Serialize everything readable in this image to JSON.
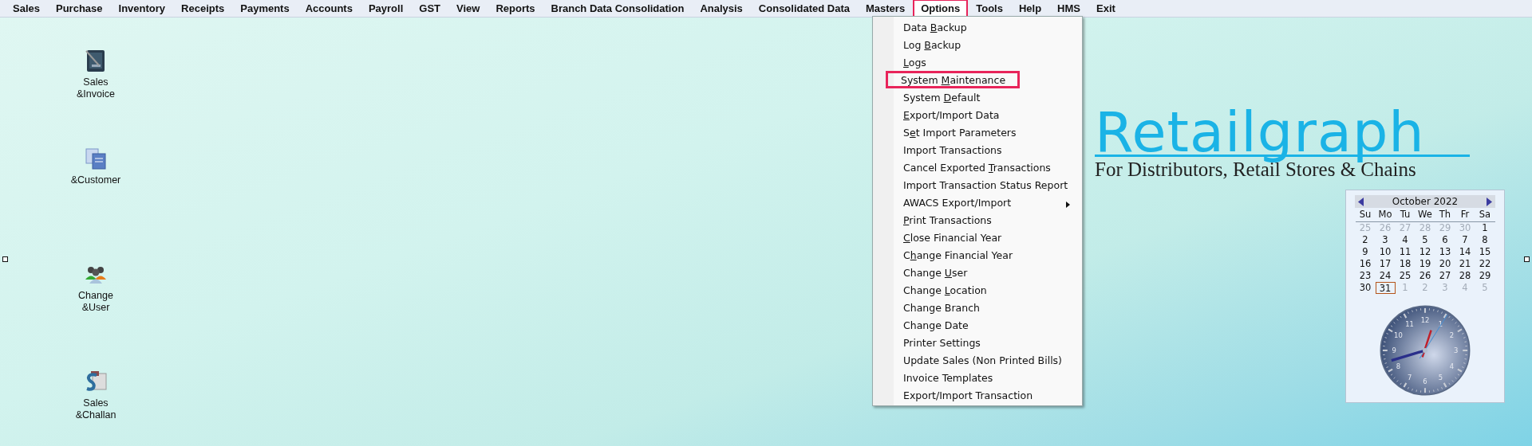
{
  "menu_bar": [
    {
      "label": "Sales",
      "highlighted": false
    },
    {
      "label": "Purchase",
      "highlighted": false
    },
    {
      "label": "Inventory",
      "highlighted": false
    },
    {
      "label": "Receipts",
      "highlighted": false
    },
    {
      "label": "Payments",
      "highlighted": false
    },
    {
      "label": "Accounts",
      "highlighted": false
    },
    {
      "label": "Payroll",
      "highlighted": false
    },
    {
      "label": "GST",
      "highlighted": false
    },
    {
      "label": "View",
      "highlighted": false
    },
    {
      "label": "Reports",
      "highlighted": false
    },
    {
      "label": "Branch Data Consolidation",
      "highlighted": false
    },
    {
      "label": "Analysis",
      "highlighted": false
    },
    {
      "label": "Consolidated Data",
      "highlighted": false
    },
    {
      "label": "Masters",
      "highlighted": false
    },
    {
      "label": "Options",
      "highlighted": true
    },
    {
      "label": "Tools",
      "highlighted": false
    },
    {
      "label": "Help",
      "highlighted": false
    },
    {
      "label": "HMS",
      "highlighted": false
    },
    {
      "label": "Exit",
      "highlighted": false
    }
  ],
  "options_menu": [
    {
      "parts": [
        {
          "text": "Data ",
          "underlined": false
        },
        {
          "text": "B",
          "underlined": true
        },
        {
          "text": "ackup",
          "underlined": false
        }
      ],
      "highlighted": false,
      "submenu": false
    },
    {
      "parts": [
        {
          "text": "Log ",
          "underlined": false
        },
        {
          "text": "B",
          "underlined": true
        },
        {
          "text": "ackup",
          "underlined": false
        }
      ],
      "highlighted": false,
      "submenu": false
    },
    {
      "parts": [
        {
          "text": "L",
          "underlined": true
        },
        {
          "text": "ogs",
          "underlined": false
        }
      ],
      "highlighted": false,
      "submenu": false
    },
    {
      "parts": [
        {
          "text": "System ",
          "underlined": false
        },
        {
          "text": "M",
          "underlined": true
        },
        {
          "text": "aintenance",
          "underlined": false
        }
      ],
      "highlighted": true,
      "submenu": false
    },
    {
      "parts": [
        {
          "text": "System ",
          "underlined": false
        },
        {
          "text": "D",
          "underlined": true
        },
        {
          "text": "efault",
          "underlined": false
        }
      ],
      "highlighted": false,
      "submenu": false
    },
    {
      "parts": [
        {
          "text": "E",
          "underlined": true
        },
        {
          "text": "xport/Import Data",
          "underlined": false
        }
      ],
      "highlighted": false,
      "submenu": false
    },
    {
      "parts": [
        {
          "text": "S",
          "underlined": false
        },
        {
          "text": "e",
          "underlined": true
        },
        {
          "text": "t Import Parameters",
          "underlined": false
        }
      ],
      "highlighted": false,
      "submenu": false
    },
    {
      "parts": [
        {
          "text": "Import Transactions",
          "underlined": false
        }
      ],
      "highlighted": false,
      "submenu": false
    },
    {
      "parts": [
        {
          "text": "Cancel Exported ",
          "underlined": false
        },
        {
          "text": "T",
          "underlined": true
        },
        {
          "text": "ransactions",
          "underlined": false
        }
      ],
      "highlighted": false,
      "submenu": false
    },
    {
      "parts": [
        {
          "text": "Import Transaction Status Report",
          "underlined": false
        }
      ],
      "highlighted": false,
      "submenu": false
    },
    {
      "parts": [
        {
          "text": "AWACS Export/Import",
          "underlined": false
        }
      ],
      "highlighted": false,
      "submenu": true
    },
    {
      "parts": [
        {
          "text": "P",
          "underlined": true
        },
        {
          "text": "rint Transactions",
          "underlined": false
        }
      ],
      "highlighted": false,
      "submenu": false
    },
    {
      "parts": [
        {
          "text": "C",
          "underlined": true
        },
        {
          "text": "lose Financial Year",
          "underlined": false
        }
      ],
      "highlighted": false,
      "submenu": false
    },
    {
      "parts": [
        {
          "text": "C",
          "underlined": false
        },
        {
          "text": "h",
          "underlined": true
        },
        {
          "text": "ange Financial Year",
          "underlined": false
        }
      ],
      "highlighted": false,
      "submenu": false
    },
    {
      "parts": [
        {
          "text": "Change ",
          "underlined": false
        },
        {
          "text": "U",
          "underlined": true
        },
        {
          "text": "ser",
          "underlined": false
        }
      ],
      "highlighted": false,
      "submenu": false
    },
    {
      "parts": [
        {
          "text": "Change ",
          "underlined": false
        },
        {
          "text": "L",
          "underlined": true
        },
        {
          "text": "ocation",
          "underlined": false
        }
      ],
      "highlighted": false,
      "submenu": false
    },
    {
      "parts": [
        {
          "text": "Change Branch",
          "underlined": false
        }
      ],
      "highlighted": false,
      "submenu": false
    },
    {
      "parts": [
        {
          "text": "Change Date",
          "underlined": false
        }
      ],
      "highlighted": false,
      "submenu": false
    },
    {
      "parts": [
        {
          "text": "Printer Settings",
          "underlined": false
        }
      ],
      "highlighted": false,
      "submenu": false
    },
    {
      "parts": [
        {
          "text": "Update Sales (Non Printed Bills)",
          "underlined": false
        }
      ],
      "highlighted": false,
      "submenu": false
    },
    {
      "parts": [
        {
          "text": "Invoice Templates",
          "underlined": false
        }
      ],
      "highlighted": false,
      "submenu": false
    },
    {
      "parts": [
        {
          "text": "Export/Import Transaction",
          "underlined": false
        }
      ],
      "highlighted": false,
      "submenu": false
    }
  ],
  "desktop_shortcuts": [
    {
      "kind": "book",
      "lines": [
        "Sales",
        "&Invoice"
      ]
    },
    {
      "kind": "documents",
      "lines": [
        "&Customer"
      ]
    },
    {
      "kind": "users",
      "lines": [
        "Change",
        "&User"
      ]
    },
    {
      "kind": "challan",
      "lines": [
        "Sales",
        "&Challan"
      ]
    }
  ],
  "logo": {
    "name": "Retailgraph",
    "tagline": "For Distributors, Retail Stores & Chains"
  },
  "calendar": {
    "title": "October  2022",
    "weekdays": [
      "Su",
      "Mo",
      "Tu",
      "We",
      "Th",
      "Fr",
      "Sa"
    ],
    "days": [
      {
        "label": "25",
        "muted": true,
        "today": false
      },
      {
        "label": "26",
        "muted": true,
        "today": false
      },
      {
        "label": "27",
        "muted": true,
        "today": false
      },
      {
        "label": "28",
        "muted": true,
        "today": false
      },
      {
        "label": "29",
        "muted": true,
        "today": false
      },
      {
        "label": "30",
        "muted": true,
        "today": false
      },
      {
        "label": "1",
        "muted": false,
        "today": false
      },
      {
        "label": "2",
        "muted": false,
        "today": false
      },
      {
        "label": "3",
        "muted": false,
        "today": false
      },
      {
        "label": "4",
        "muted": false,
        "today": false
      },
      {
        "label": "5",
        "muted": false,
        "today": false
      },
      {
        "label": "6",
        "muted": false,
        "today": false
      },
      {
        "label": "7",
        "muted": false,
        "today": false
      },
      {
        "label": "8",
        "muted": false,
        "today": false
      },
      {
        "label": "9",
        "muted": false,
        "today": false
      },
      {
        "label": "10",
        "muted": false,
        "today": false
      },
      {
        "label": "11",
        "muted": false,
        "today": false
      },
      {
        "label": "12",
        "muted": false,
        "today": false
      },
      {
        "label": "13",
        "muted": false,
        "today": false
      },
      {
        "label": "14",
        "muted": false,
        "today": false
      },
      {
        "label": "15",
        "muted": false,
        "today": false
      },
      {
        "label": "16",
        "muted": false,
        "today": false
      },
      {
        "label": "17",
        "muted": false,
        "today": false
      },
      {
        "label": "18",
        "muted": false,
        "today": false
      },
      {
        "label": "19",
        "muted": false,
        "today": false
      },
      {
        "label": "20",
        "muted": false,
        "today": false
      },
      {
        "label": "21",
        "muted": false,
        "today": false
      },
      {
        "label": "22",
        "muted": false,
        "today": false
      },
      {
        "label": "23",
        "muted": false,
        "today": false
      },
      {
        "label": "24",
        "muted": false,
        "today": false
      },
      {
        "label": "25",
        "muted": false,
        "today": false
      },
      {
        "label": "26",
        "muted": false,
        "today": false
      },
      {
        "label": "27",
        "muted": false,
        "today": false
      },
      {
        "label": "28",
        "muted": false,
        "today": false
      },
      {
        "label": "29",
        "muted": false,
        "today": false
      },
      {
        "label": "30",
        "muted": false,
        "today": false
      },
      {
        "label": "31",
        "muted": false,
        "today": true
      },
      {
        "label": "1",
        "muted": true,
        "today": false
      },
      {
        "label": "2",
        "muted": true,
        "today": false
      },
      {
        "label": "3",
        "muted": true,
        "today": false
      },
      {
        "label": "4",
        "muted": true,
        "today": false
      },
      {
        "label": "5",
        "muted": true,
        "today": false
      }
    ]
  },
  "clock": {
    "numbers": [
      "12",
      "1",
      "2",
      "3",
      "4",
      "5",
      "6",
      "7",
      "8",
      "9",
      "10",
      "11"
    ]
  }
}
